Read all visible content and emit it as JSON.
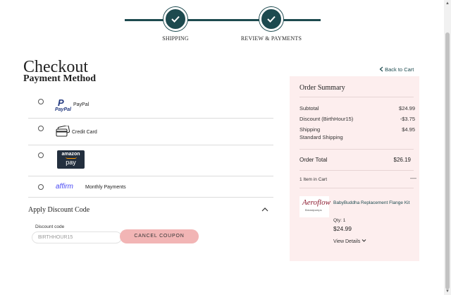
{
  "stepper": {
    "steps": [
      {
        "label": "SHIPPING"
      },
      {
        "label": "REVIEW & PAYMENTS"
      }
    ]
  },
  "page": {
    "title": "Checkout",
    "subtitle": "Payment Method",
    "back_to_cart": "Back to Cart"
  },
  "payment_methods": [
    {
      "id": "paypal",
      "label": "PayPal",
      "logo_text": "PayPal",
      "logo_mark": "P"
    },
    {
      "id": "credit",
      "label": "Credit Card"
    },
    {
      "id": "amazon",
      "logo_text_top": "amazon",
      "logo_text_bottom": "pay"
    },
    {
      "id": "affirm",
      "logo_text": "affirm",
      "label": "Monthly Payments"
    }
  ],
  "discount": {
    "title": "Apply Discount Code",
    "field_label": "Discount code",
    "value": "BIRTHHOUR15",
    "cancel_label": "CANCEL COUPON"
  },
  "summary": {
    "title": "Order Summary",
    "rows": [
      {
        "label": "Subtotal",
        "value": "$24.99"
      },
      {
        "label": "Discount (BirthHour15)",
        "value": "-$3.75"
      },
      {
        "label": "Shipping",
        "value": "$4.95"
      }
    ],
    "shipping_method": "Standard Shipping",
    "total_label": "Order Total",
    "total_value": "$26.19",
    "items_count": "1 Item in Cart",
    "items_toggle": "—",
    "product": {
      "brand": "Aeroflow",
      "brand_sub": "Breastpumps",
      "name": "BabyBuddha Replacement Flange Kit",
      "qty": "Qty: 1",
      "price": "$24.99",
      "view_details": "View Details"
    }
  },
  "colors": {
    "primary": "#1d4a4f",
    "summary_bg": "#fdeeee",
    "cancel_button": "#f2b5b5"
  }
}
